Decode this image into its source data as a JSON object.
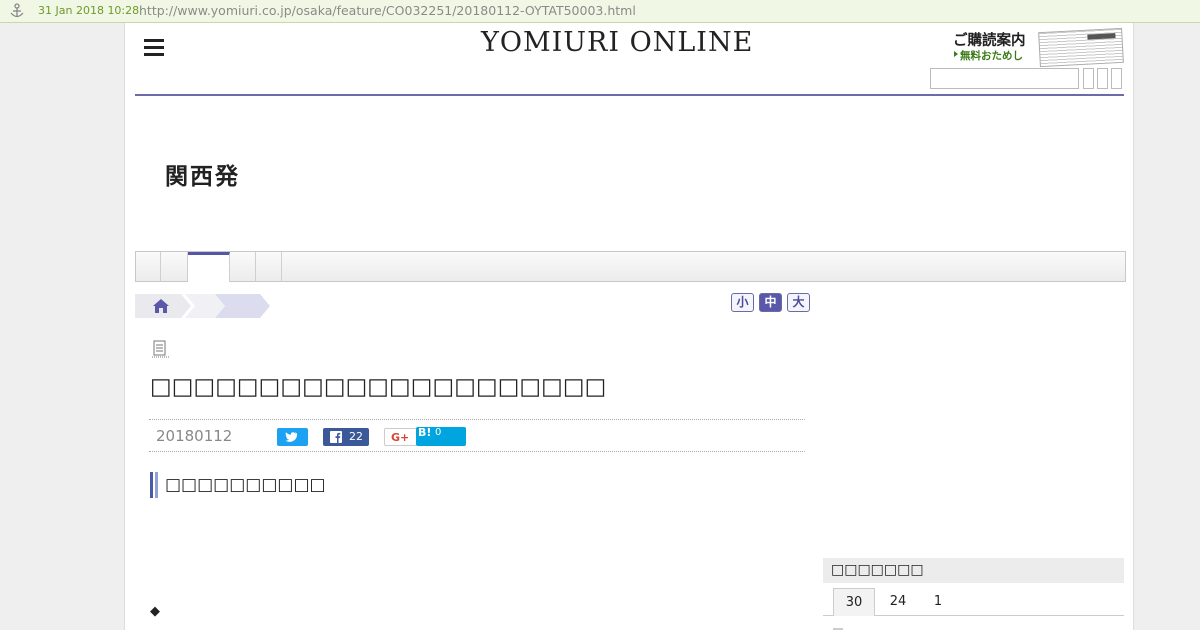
{
  "archive": {
    "date": "31 Jan 2018 10:28",
    "url": "http://www.yomiuri.co.jp/osaka/feature/CO032251/20180112-OYTAT50003.html"
  },
  "header": {
    "logo": "YOMIURI ONLINE",
    "subscribe_line1": "ご購読案内",
    "subscribe_line2": "無料おためし",
    "search_placeholder": ""
  },
  "section": {
    "title": "関西発"
  },
  "font_size": {
    "small": "小",
    "medium": "中",
    "large": "大",
    "selected": "中"
  },
  "article": {
    "title": "□□□□□□□□□□□□□□□□□□□□□",
    "date": "20180112",
    "facebook_count": "22",
    "gplus_label": "G+",
    "hatena_label": "B!",
    "hatena_count": "0",
    "subhead": "□□□□□□□□□□",
    "bullet": "◆"
  },
  "ranking": {
    "title": "□□□□□□□",
    "tabs": [
      "30",
      "24",
      "1"
    ]
  },
  "colors": {
    "accent": "#5755a6",
    "twitter": "#1da1f2",
    "facebook": "#3b5998",
    "hatena": "#00a4de"
  }
}
